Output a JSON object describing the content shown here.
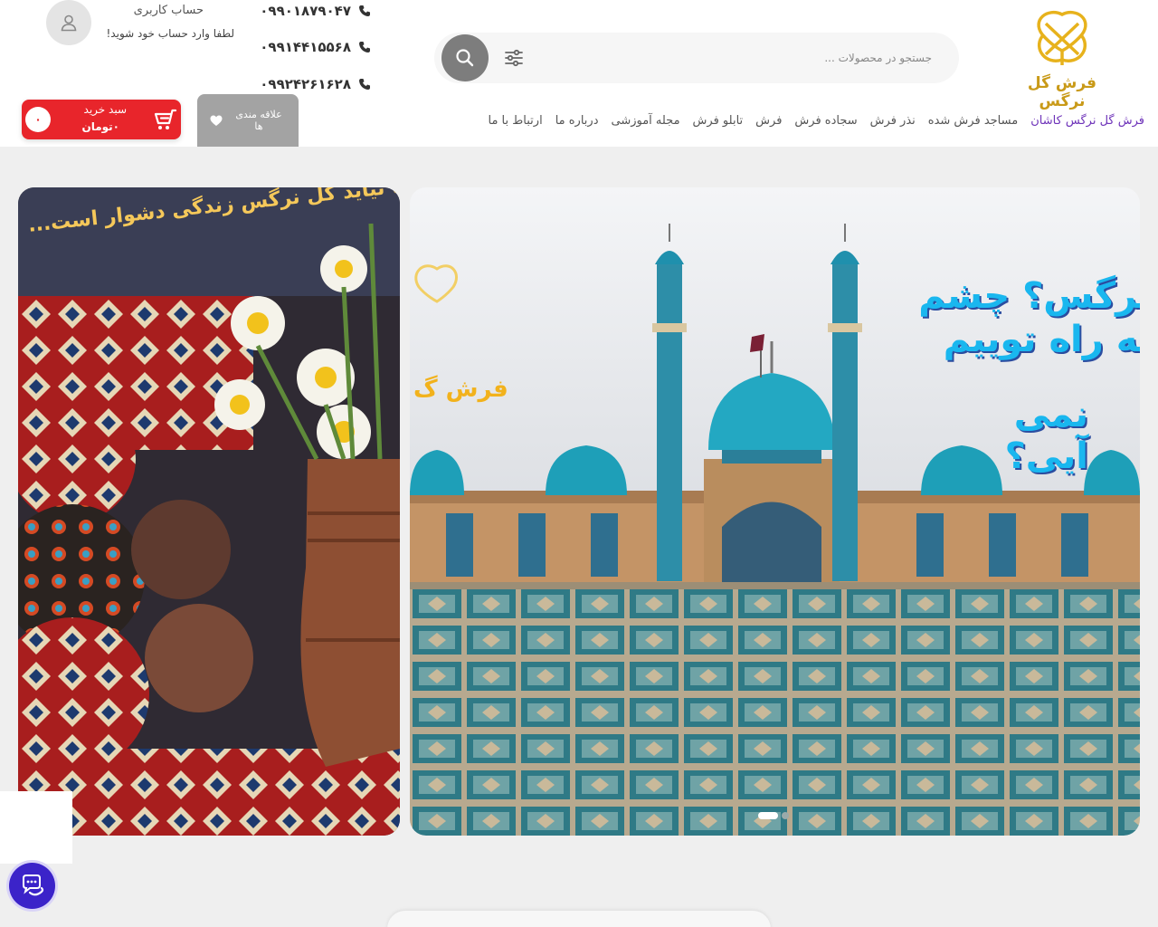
{
  "brand": {
    "logo_text": "فرش گل نرگس",
    "accent": "#c99a18"
  },
  "search": {
    "placeholder": "جستجو در محصولات ...",
    "value": ""
  },
  "phones": [
    "۰۹۹۰۱۸۷۹۰۴۷",
    "۰۹۹۱۴۴۱۵۵۶۸",
    "۰۹۹۲۴۲۶۱۶۲۸"
  ],
  "account": {
    "title": "حساب کاربری",
    "subtitle": "لطفا وارد حساب خود شوید!"
  },
  "nav": {
    "items": [
      {
        "label": "فرش گل نرگس کاشان",
        "active": true
      },
      {
        "label": "مساجد فرش شده"
      },
      {
        "label": "نذر فرش"
      },
      {
        "label": "سجاده فرش"
      },
      {
        "label": "فرش"
      },
      {
        "label": "تابلو فرش"
      },
      {
        "label": "مجله آموزشی"
      },
      {
        "label": "درباره ما"
      },
      {
        "label": "ارتباط با ما"
      }
    ],
    "active_color": "#6e33b9"
  },
  "wishlist": {
    "label": "علاقه مندی ها"
  },
  "cart": {
    "title": "سبد خرید",
    "total": "۰تومان",
    "count": "۰",
    "color": "#e8252b"
  },
  "banner_main": {
    "caption_lines": [
      "نرگس؟ چشم به راه توییم",
      "نمی آیی؟"
    ],
    "logo_text": "فرش گ"
  },
  "banner_side": {
    "caption": "تا نیاید گل نرگس زندگی دشوار است..."
  },
  "slider": {
    "dots": 2,
    "active_index": 1
  }
}
